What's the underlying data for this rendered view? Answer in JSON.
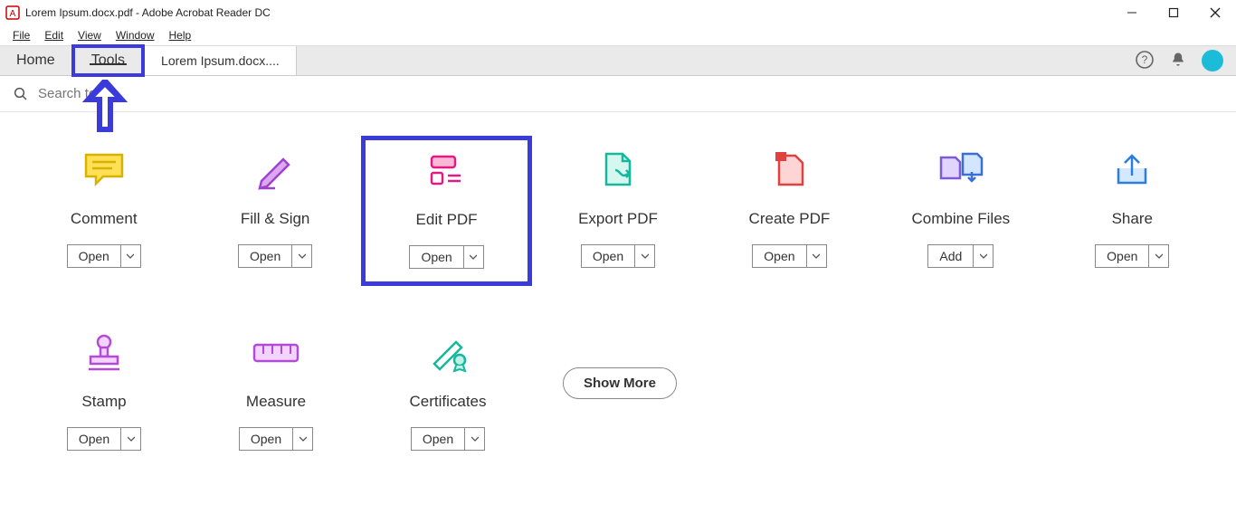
{
  "window": {
    "title": "Lorem Ipsum.docx.pdf - Adobe Acrobat Reader DC"
  },
  "menu": {
    "file": "File",
    "edit": "Edit",
    "view": "View",
    "window": "Window",
    "help": "Help"
  },
  "tabs": {
    "home": "Home",
    "tools": "Tools",
    "doc": "Lorem Ipsum.docx...."
  },
  "search": {
    "placeholder": "Search tools"
  },
  "tools": {
    "comment": {
      "label": "Comment",
      "action": "Open"
    },
    "fillsign": {
      "label": "Fill & Sign",
      "action": "Open"
    },
    "editpdf": {
      "label": "Edit PDF",
      "action": "Open"
    },
    "exportpdf": {
      "label": "Export PDF",
      "action": "Open"
    },
    "createpdf": {
      "label": "Create PDF",
      "action": "Open"
    },
    "combine": {
      "label": "Combine Files",
      "action": "Add"
    },
    "share": {
      "label": "Share",
      "action": "Open"
    },
    "stamp": {
      "label": "Stamp",
      "action": "Open"
    },
    "measure": {
      "label": "Measure",
      "action": "Open"
    },
    "certificates": {
      "label": "Certificates",
      "action": "Open"
    }
  },
  "showmore": "Show More"
}
